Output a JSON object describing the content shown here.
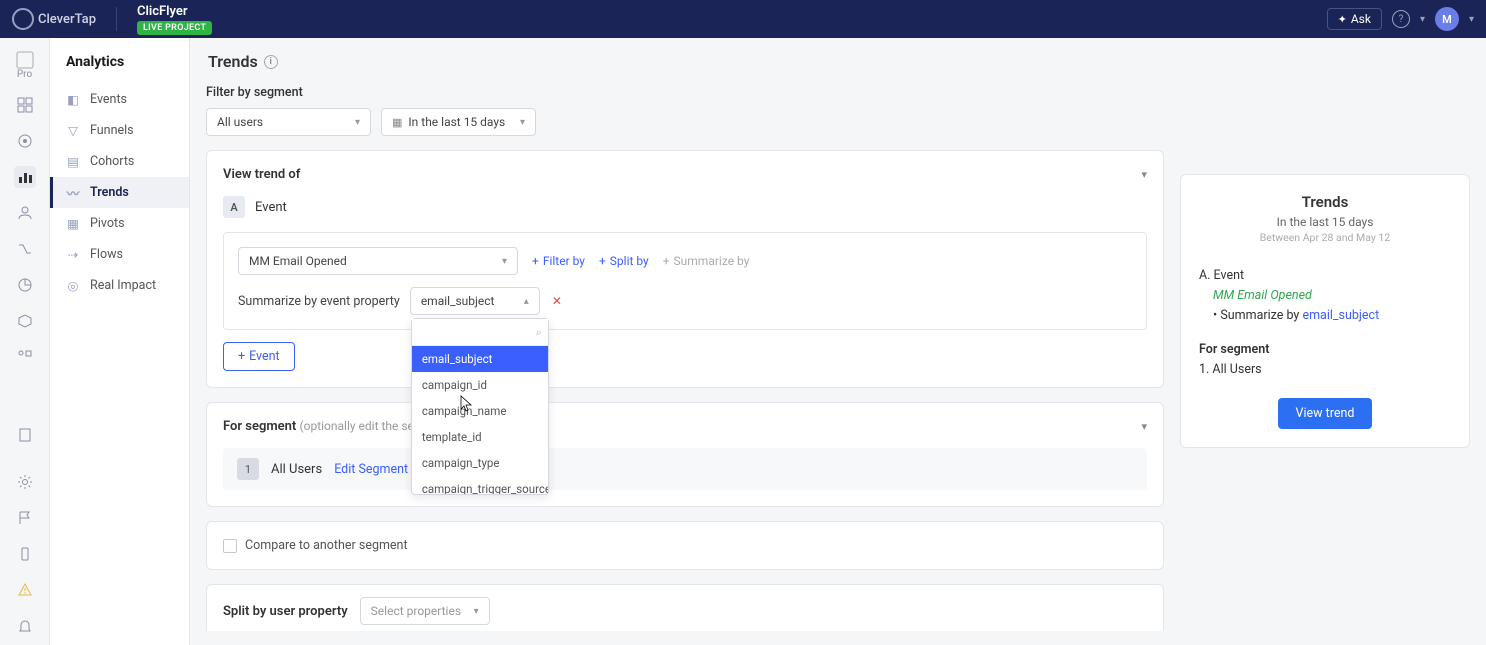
{
  "topnav": {
    "brand": "CleverTap",
    "project": "ClicFlyer",
    "badge": "LIVE PROJECT",
    "ask": "Ask",
    "avatar_initial": "M"
  },
  "rail": {
    "pro_label": "Pro"
  },
  "subnav": {
    "title": "Analytics",
    "items": [
      {
        "label": "Events"
      },
      {
        "label": "Funnels"
      },
      {
        "label": "Cohorts"
      },
      {
        "label": "Trends",
        "active": true
      },
      {
        "label": "Pivots"
      },
      {
        "label": "Flows"
      },
      {
        "label": "Real Impact"
      }
    ]
  },
  "page": {
    "title": "Trends",
    "filter_label": "Filter by segment",
    "user_dd": "All users",
    "date_dd": "In the last 15 days"
  },
  "trend_card": {
    "title": "View trend of",
    "event_letter": "A",
    "event_label": "Event",
    "selected_event": "MM Email Opened",
    "filter_by": "Filter by",
    "split_by": "Split by",
    "summarize_by": "Summarize by",
    "sum_label": "Summarize by event property",
    "sum_selected": "email_subject",
    "dropdown_options": [
      "email_subject",
      "campaign_id",
      "campaign_name",
      "template_id",
      "campaign_type",
      "campaign_trigger_source"
    ],
    "add_event": "Event"
  },
  "segment_card": {
    "title": "For segment",
    "optional": "(optionally edit the se",
    "num": "1",
    "name": "All Users",
    "edit": "Edit Segment"
  },
  "compare_card": {
    "label": "Compare to another segment"
  },
  "split_card": {
    "label": "Split by user property",
    "placeholder": "Select properties"
  },
  "side": {
    "title": "Trends",
    "sub": "In the last 15 days",
    "between": "Between Apr 28 and May 12",
    "a_label": "A. Event",
    "a_event": "MM Email Opened",
    "sum_prefix": "Summarize by",
    "sum_val": "email_subject",
    "seg_title": "For segment",
    "seg_line": "1. All Users",
    "btn": "View trend"
  }
}
